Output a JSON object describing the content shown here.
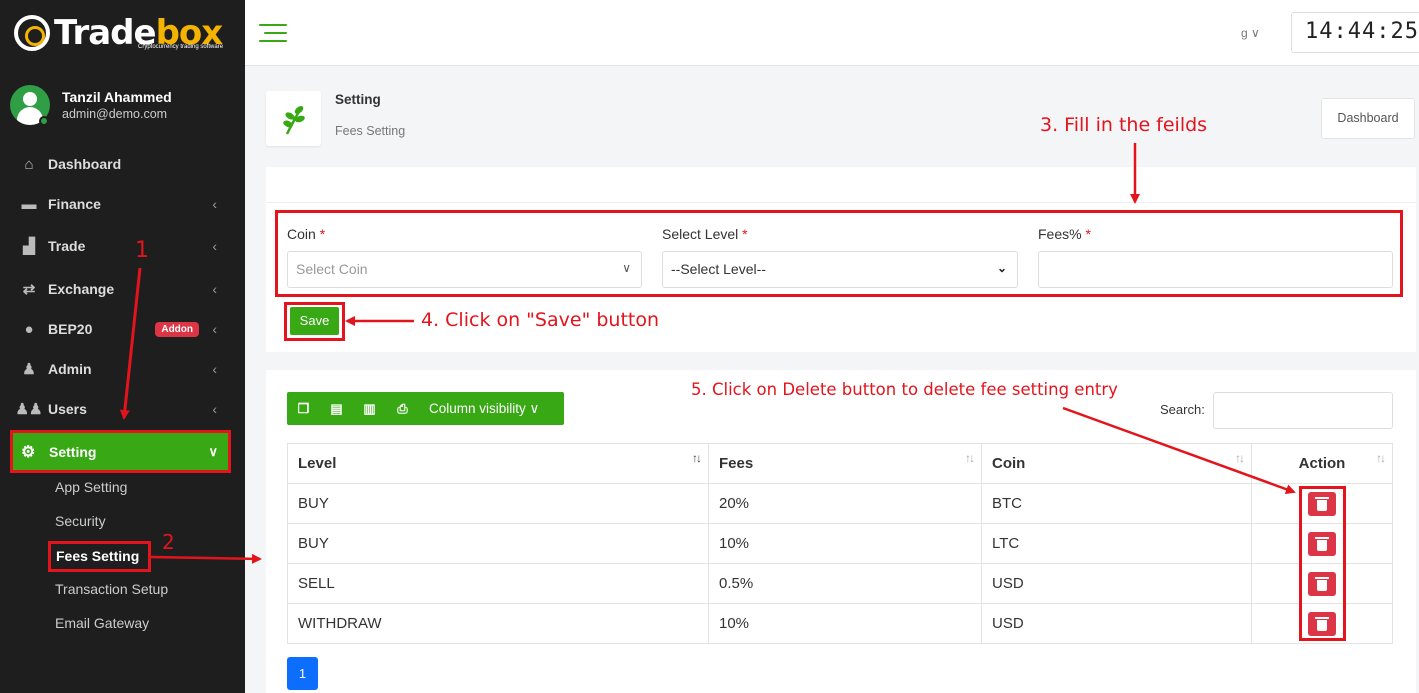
{
  "brand": {
    "name_part1": "Trade",
    "name_part2": "box",
    "tagline": "Cryptocurrency trading software"
  },
  "user": {
    "name": "Tanzil Ahammed",
    "email": "admin@demo.com"
  },
  "sidebar": {
    "items": [
      {
        "label": "Dashboard",
        "icon": "home-icon"
      },
      {
        "label": "Finance",
        "icon": "wallet-icon"
      },
      {
        "label": "Trade",
        "icon": "chart-icon"
      },
      {
        "label": "Exchange",
        "icon": "exchange-icon"
      },
      {
        "label": "BEP20",
        "icon": "coins-icon",
        "badge": "Addon"
      },
      {
        "label": "Admin",
        "icon": "user-icon"
      },
      {
        "label": "Users",
        "icon": "users-icon"
      }
    ],
    "active": {
      "label": "Setting",
      "icon": "gear-icon"
    },
    "sub_items": [
      "App Setting",
      "Security",
      "Fees Setting",
      "Transaction Setup",
      "Email Gateway"
    ]
  },
  "topbar": {
    "language": "g",
    "clock": "14:44:25"
  },
  "breadcrumb": {
    "title": "Setting",
    "subtitle": "Fees Setting",
    "dashboard_button": "Dashboard"
  },
  "form": {
    "coin_label": "Coin",
    "coin_placeholder": "Select Coin",
    "level_label": "Select Level",
    "level_value": "--Select Level--",
    "fees_label": "Fees%",
    "fees_value": "",
    "required_mark": "*",
    "save_label": "Save"
  },
  "table_tools": {
    "column_visibility": "Column visibility",
    "search_label": "Search:"
  },
  "table": {
    "headers": [
      "Level",
      "Fees",
      "Coin",
      "Action"
    ],
    "rows": [
      {
        "level": "BUY",
        "fees": "20%",
        "coin": "BTC"
      },
      {
        "level": "BUY",
        "fees": "10%",
        "coin": "LTC"
      },
      {
        "level": "SELL",
        "fees": "0.5%",
        "coin": "USD"
      },
      {
        "level": "WITHDRAW",
        "fees": "10%",
        "coin": "USD"
      }
    ]
  },
  "pagination": {
    "current": "1"
  },
  "annotations": {
    "step1": "1",
    "step2": "2",
    "step3": "3. Fill in the feilds",
    "step4": "4. Click on \"Save\" button",
    "step5": "5. Click on Delete button to delete fee setting entry",
    "color": "#e3141b"
  },
  "colors": {
    "accent": "#38a814",
    "sidebar_bg": "#1e1e1e",
    "danger": "#dc3545",
    "primary": "#0d6efd"
  }
}
